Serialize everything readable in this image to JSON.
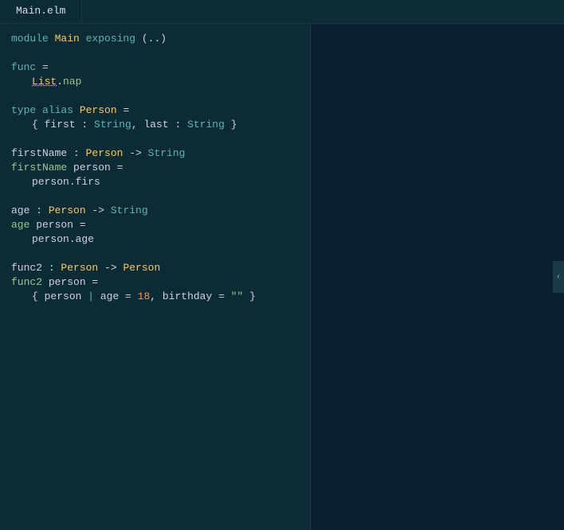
{
  "tab": {
    "label": "Main.elm"
  },
  "editor": {
    "lines": [
      {
        "type": "module_decl"
      },
      {
        "type": "empty"
      },
      {
        "type": "func_def"
      },
      {
        "type": "list_nap"
      },
      {
        "type": "empty"
      },
      {
        "type": "type_alias_decl"
      },
      {
        "type": "type_alias_body"
      },
      {
        "type": "empty"
      },
      {
        "type": "firstname_sig"
      },
      {
        "type": "firstname_def"
      },
      {
        "type": "firstname_body"
      },
      {
        "type": "empty"
      },
      {
        "type": "age_sig"
      },
      {
        "type": "age_def"
      },
      {
        "type": "age_body"
      },
      {
        "type": "empty"
      },
      {
        "type": "func2_sig"
      },
      {
        "type": "func2_def"
      },
      {
        "type": "func2_body"
      },
      {
        "type": "empty"
      }
    ]
  },
  "collapse_button": {
    "icon": "‹"
  }
}
